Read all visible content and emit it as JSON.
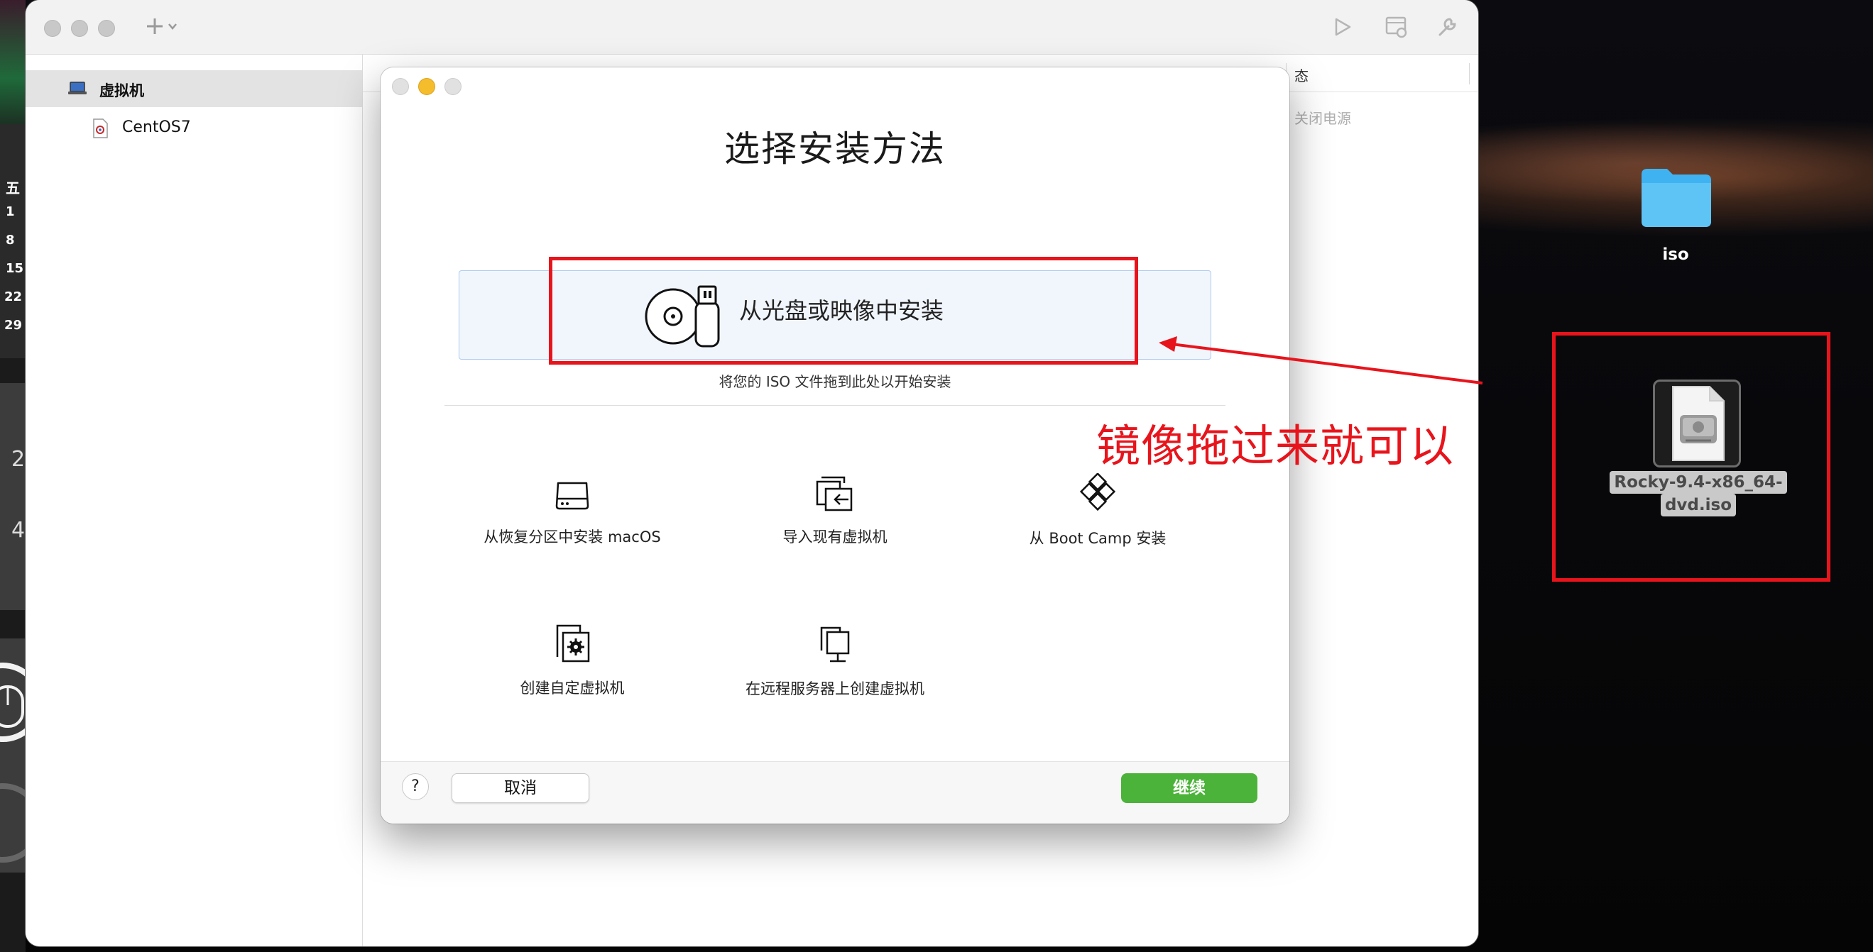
{
  "sidebar": {
    "group_label": "虚拟机",
    "items": [
      {
        "label": "CentOS7"
      }
    ]
  },
  "table": {
    "header_status": "态",
    "row_status": "关闭电源"
  },
  "dialog": {
    "title": "选择安装方法",
    "drop_zone": {
      "label": "从光盘或映像中安装",
      "hint": "将您的 ISO 文件拖到此处以开始安装"
    },
    "options": [
      {
        "label": "从恢复分区中安装 macOS",
        "icon": "hard-drive-icon"
      },
      {
        "label": "导入现有虚拟机",
        "icon": "import-vm-icon"
      },
      {
        "label": "从 Boot Camp 安装",
        "icon": "bootcamp-icon"
      },
      {
        "label": "创建自定虚拟机",
        "icon": "custom-vm-icon"
      },
      {
        "label": "在远程服务器上创建虚拟机",
        "icon": "remote-server-icon"
      }
    ],
    "help_label": "?",
    "cancel_label": "取消",
    "continue_label": "继续"
  },
  "annotation": {
    "text": "镜像拖过来就可以",
    "color": "#e8141c"
  },
  "desktop": {
    "folder_label": "iso",
    "iso_file_line1": "Rocky-9.4-x86_64-",
    "iso_file_line2": "dvd.iso"
  },
  "calendar": {
    "weekday": "五",
    "dates": [
      "1",
      "8",
      "15",
      "22",
      "29"
    ]
  },
  "clock_digits": [
    "2",
    "4"
  ],
  "colors": {
    "accent_green": "#4cb33a",
    "drop_zone_bg": "#f1f6fd",
    "traffic_yellow": "#f5bc2c",
    "folder_blue": "#3fb3f2"
  }
}
